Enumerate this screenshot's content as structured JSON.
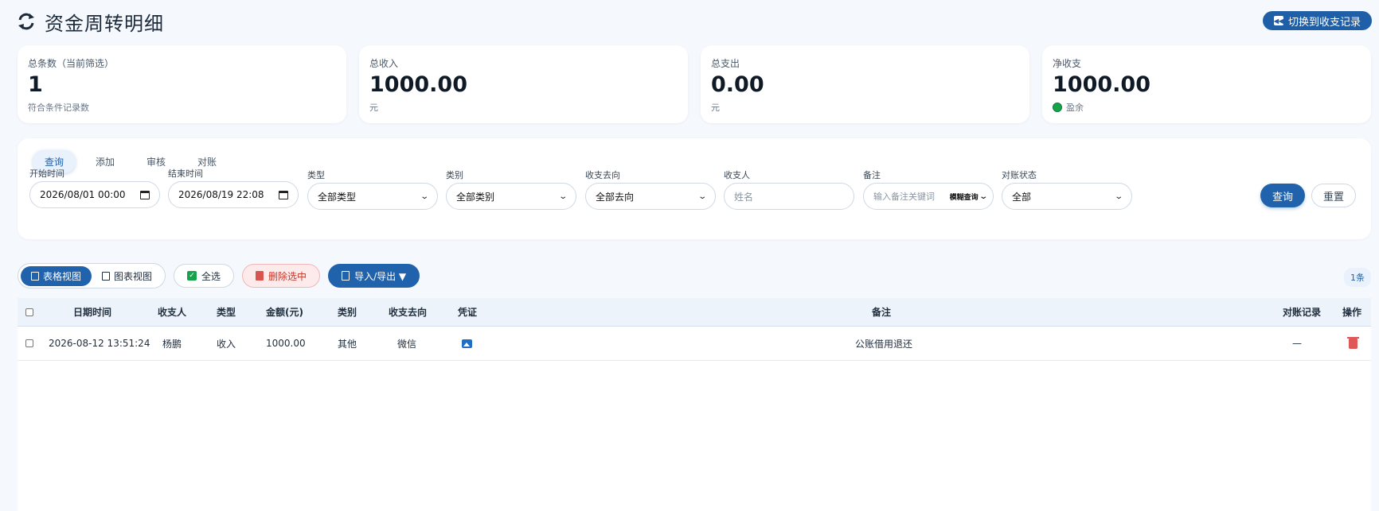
{
  "header": {
    "title": "资金周转明细",
    "switch_label": "切换到收支记录"
  },
  "stats": [
    {
      "label": "总条数（当前筛选）",
      "value": "1",
      "sub": "符合条件记录数"
    },
    {
      "label": "总收入",
      "value": "1000.00",
      "sub": "元"
    },
    {
      "label": "总支出",
      "value": "0.00",
      "sub": "元"
    },
    {
      "label": "净收支",
      "value": "1000.00",
      "sub": "盈余",
      "sub_color": "#16a34a"
    }
  ],
  "tabs": [
    "查询",
    "添加",
    "审核",
    "对账"
  ],
  "filters": {
    "start": {
      "label": "开始时间",
      "value": "2026/08/01 00:00"
    },
    "end": {
      "label": "结束时间",
      "value": "2026/08/19 22:08"
    },
    "type": {
      "label": "类型",
      "value": "全部类型"
    },
    "category": {
      "label": "类别",
      "value": "全部类别"
    },
    "direction": {
      "label": "收支去向",
      "value": "全部去向"
    },
    "payee": {
      "label": "收支人",
      "placeholder": "姓名"
    },
    "remark": {
      "label": "备注",
      "placeholder": "输入备注关键词",
      "mode": "模糊查询"
    },
    "recon": {
      "label": "对账状态",
      "value": "全部"
    },
    "query_label": "查询",
    "reset_label": "重置"
  },
  "toolbar": {
    "table_view": "表格视图",
    "chart_view": "图表视图",
    "select_all": "全选",
    "delete_selected": "删除选中",
    "import_export": "导入/导出 ▼",
    "count": "1条"
  },
  "table": {
    "headers": [
      "日期时间",
      "收支人",
      "类型",
      "金额(元)",
      "类别",
      "收支去向",
      "凭证",
      "备注",
      "对账记录",
      "操作"
    ],
    "rows": [
      {
        "datetime": "2026-08-12 13:51:24",
        "payee": "杨鹏",
        "type": "收入",
        "amount": "1000.00",
        "category": "其他",
        "direction": "微信",
        "remark": "公账借用退还",
        "recon": "—"
      }
    ]
  },
  "colors": {
    "primary": "#2063ac",
    "accent_bg": "#e9f2fc",
    "success": "#16a34a",
    "danger": "#e05757"
  }
}
